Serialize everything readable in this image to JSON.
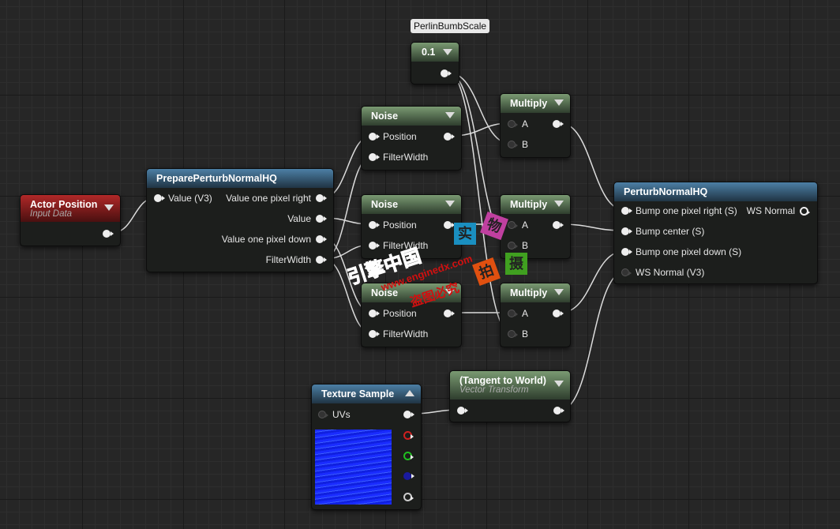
{
  "param": {
    "tooltip": "PerlinBumbScale",
    "value": "0.1"
  },
  "actor": {
    "title": "Actor Position",
    "subtitle": "Input Data"
  },
  "prepare": {
    "title": "PreparePerturbNormalHQ",
    "input": "Value (V3)",
    "outputs": [
      "Value one pixel right",
      "Value",
      "Value one pixel down",
      "FilterWidth"
    ]
  },
  "noise": {
    "title": "Noise",
    "inputs": [
      "Position",
      "FilterWidth"
    ]
  },
  "multiply": {
    "title": "Multiply",
    "inputs": [
      "A",
      "B"
    ]
  },
  "perturb": {
    "title": "PerturbNormalHQ",
    "inputs": [
      "Bump one pixel right (S)",
      "Bump center (S)",
      "Bump one pixel down (S)",
      "WS Normal (V3)"
    ],
    "output": "WS Normal"
  },
  "texture": {
    "title": "Texture Sample",
    "input": "UVs",
    "pin_colors": [
      "#ffffff",
      "#d02020",
      "#20c020",
      "#2020d0",
      "#cccccc"
    ]
  },
  "transform": {
    "title": "(Tangent to World)",
    "subtitle": "Vector Transform"
  },
  "watermark": {
    "cn": "引擎中国",
    "url": "www.enginedx.com",
    "warn": "盗图必究",
    "squares": [
      "实",
      "物",
      "拍",
      "摄"
    ]
  },
  "colors": {
    "green_header": "#5d7a56",
    "blue_header": "#3b6788",
    "red_header": "#9a2020",
    "wire": "#e0e0e0"
  }
}
